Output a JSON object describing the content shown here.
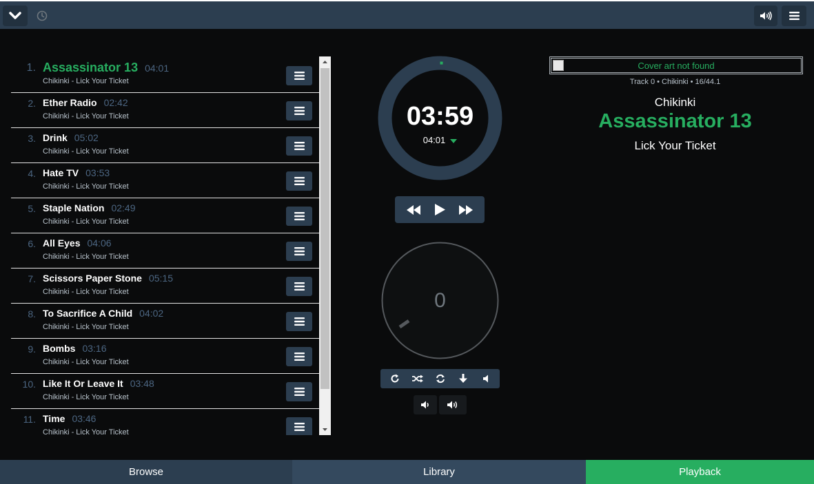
{
  "colors": {
    "accent": "#27ae60",
    "panel": "#2c3e50",
    "background": "#0a0b0c",
    "muted": "#4c6682"
  },
  "topbar": {
    "icons": [
      "chevron-down-icon",
      "history-icon",
      "volume-icon",
      "hamburger-icon"
    ]
  },
  "playlist": {
    "items": [
      {
        "num": "1.",
        "title": "Assassinator 13",
        "duration": "04:01",
        "subtitle": "Chikinki - Lick Your Ticket",
        "active": true
      },
      {
        "num": "2.",
        "title": "Ether Radio",
        "duration": "02:42",
        "subtitle": "Chikinki - Lick Your Ticket"
      },
      {
        "num": "3.",
        "title": "Drink",
        "duration": "05:02",
        "subtitle": "Chikinki - Lick Your Ticket"
      },
      {
        "num": "4.",
        "title": "Hate TV",
        "duration": "03:53",
        "subtitle": "Chikinki - Lick Your Ticket"
      },
      {
        "num": "5.",
        "title": "Staple Nation",
        "duration": "02:49",
        "subtitle": "Chikinki - Lick Your Ticket"
      },
      {
        "num": "6.",
        "title": "All Eyes",
        "duration": "04:06",
        "subtitle": "Chikinki - Lick Your Ticket"
      },
      {
        "num": "7.",
        "title": "Scissors Paper Stone",
        "duration": "05:15",
        "subtitle": "Chikinki - Lick Your Ticket"
      },
      {
        "num": "8.",
        "title": "To Sacrifice A Child",
        "duration": "04:02",
        "subtitle": "Chikinki - Lick Your Ticket"
      },
      {
        "num": "9.",
        "title": "Bombs",
        "duration": "03:16",
        "subtitle": "Chikinki - Lick Your Ticket"
      },
      {
        "num": "10.",
        "title": "Like It Or Leave It",
        "duration": "03:48",
        "subtitle": "Chikinki - Lick Your Ticket"
      },
      {
        "num": "11.",
        "title": "Time",
        "duration": "03:46",
        "subtitle": "Chikinki - Lick Your Ticket"
      }
    ]
  },
  "player": {
    "elapsed": "03:59",
    "total": "04:01",
    "progress_fraction": 0.008,
    "knob_value": "0",
    "transport_icons": [
      "rewind-icon",
      "play-icon",
      "fast-forward-icon"
    ],
    "option_icons": [
      "repeat-icon",
      "shuffle-icon",
      "consume-icon",
      "download-icon",
      "volume-off-icon"
    ],
    "volume_icons": [
      "volume-down-icon",
      "volume-up-icon"
    ]
  },
  "now_playing": {
    "cover_alt": "Cover art not found",
    "track_info": "Track 0 • Chikinki • 16/44.1",
    "artist": "Chikinki",
    "title": "Assassinator 13",
    "album": "Lick Your Ticket"
  },
  "tabs": {
    "browse": "Browse",
    "library": "Library",
    "playback": "Playback"
  }
}
